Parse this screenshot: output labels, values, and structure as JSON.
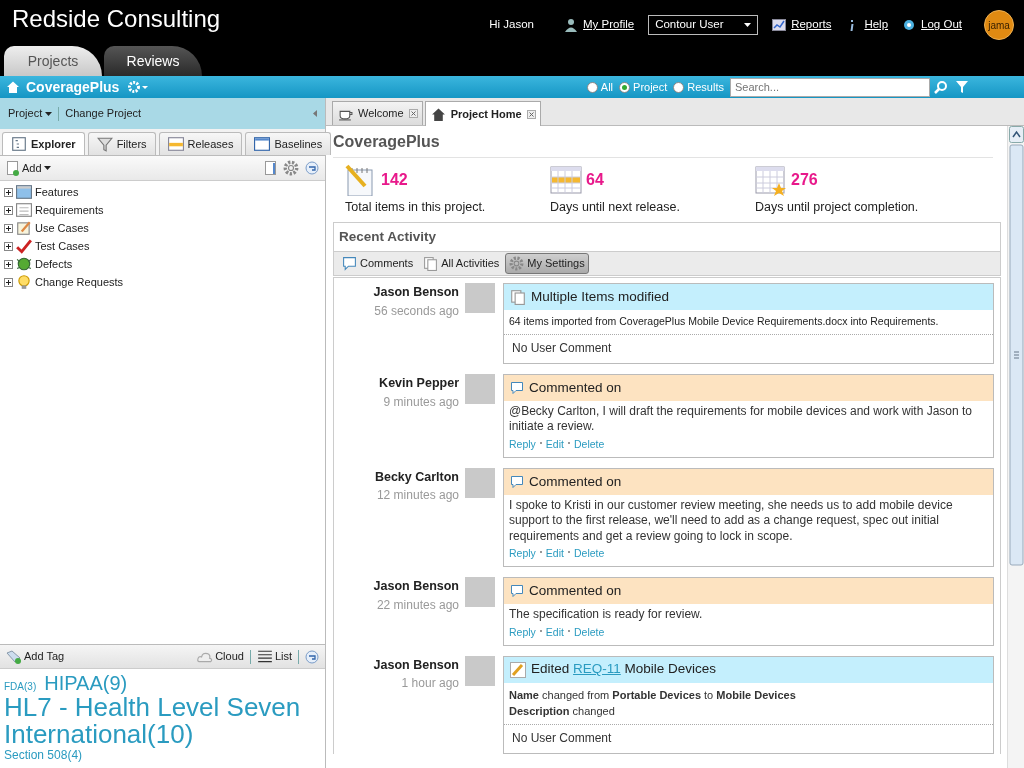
{
  "header": {
    "company": "Redside Consulting",
    "greeting": "Hi Jason",
    "logo": "jama",
    "nav": [
      {
        "kind": "profile",
        "label": "My Profile"
      },
      {
        "kind": "select",
        "label": "Contour User"
      },
      {
        "kind": "reports",
        "label": "Reports"
      },
      {
        "kind": "help",
        "label": "Help"
      },
      {
        "kind": "logout",
        "label": "Log Out"
      }
    ]
  },
  "main_tabs": [
    {
      "label": "Projects",
      "selected": true
    },
    {
      "label": "Reviews",
      "selected": false
    }
  ],
  "project_bar": {
    "name": "CoveragePlus",
    "scope": [
      {
        "label": "All",
        "selected": false
      },
      {
        "label": "Project",
        "selected": true
      },
      {
        "label": "Results",
        "selected": false
      }
    ],
    "search": {
      "placeholder": "Search..."
    }
  },
  "sidebar": {
    "menu": [
      "Project",
      "Change Project"
    ],
    "tabs": [
      {
        "label": "Explorer",
        "kind": "explorer",
        "selected": true
      },
      {
        "label": "Filters",
        "kind": "filter",
        "selected": false
      },
      {
        "label": "Releases",
        "kind": "releases",
        "selected": false
      },
      {
        "label": "Baselines",
        "kind": "baselines",
        "selected": false
      }
    ],
    "add": "Add",
    "tree": [
      {
        "label": "Features",
        "kind": "features",
        "expanded": false
      },
      {
        "label": "Requirements",
        "kind": "requirements",
        "expanded": false
      },
      {
        "label": "Use Cases",
        "kind": "usecases",
        "expanded": false
      },
      {
        "label": "Test Cases",
        "kind": "testcases",
        "expanded": false
      },
      {
        "label": "Defects",
        "kind": "defects",
        "expanded": false
      },
      {
        "label": "Change Requests",
        "kind": "changes",
        "expanded": false
      }
    ],
    "tag_toolbar": {
      "add": "Add Tag",
      "views": [
        {
          "kind": "cloud",
          "label": "Cloud"
        },
        {
          "kind": "list",
          "label": "List"
        }
      ]
    },
    "tags": [
      {
        "label": "FDA(3)",
        "kind": "tiny"
      },
      {
        "label": "HIPAA(9)",
        "kind": "medium"
      },
      {
        "label": "HL7 - Health Level Seven International(10)",
        "kind": "large"
      },
      {
        "label": "Section 508(4)",
        "kind": "small"
      }
    ]
  },
  "doc_tabs": [
    {
      "label": "Welcome",
      "kind": "welcome",
      "selected": false
    },
    {
      "label": "Project Home",
      "kind": "home",
      "selected": true
    }
  ],
  "project": {
    "title": "CoveragePlus",
    "stats": [
      {
        "kind": "items",
        "value": "142",
        "label": "Total items in this project."
      },
      {
        "kind": "release",
        "value": "64",
        "label": "Days until next release."
      },
      {
        "kind": "completion",
        "value": "276",
        "label": "Days until project completion."
      }
    ]
  },
  "recent_activity": {
    "title": "Recent Activity",
    "filters": [
      {
        "kind": "comments",
        "label": "Comments",
        "selected": false
      },
      {
        "kind": "all",
        "label": "All Activities",
        "selected": false
      },
      {
        "kind": "settings",
        "label": "My Settings",
        "selected": true
      }
    ],
    "items": [
      {
        "kind": "bulk",
        "user": "Jason Benson",
        "time": "56 seconds ago",
        "title": "Multiple Items modified",
        "detail": "64 items imported from CoveragePlus Mobile Device Requirements.docx into Requirements.",
        "comment": "No User Comment"
      },
      {
        "kind": "comment",
        "user": "Kevin Pepper",
        "time": "9 minutes ago",
        "title": "Commented on",
        "body": "@Becky Carlton, I will draft the requirements for mobile devices and work with Jason to initiate a review.",
        "actions": [
          "Reply",
          "Edit",
          "Delete"
        ]
      },
      {
        "kind": "comment",
        "user": "Becky Carlton",
        "time": "12 minutes ago",
        "title": "Commented on",
        "body": "I spoke to Kristi in our customer review meeting, she needs us to add mobile device support to the first release, we'll need to add as a change request, spec out initial requirements and get a review going to lock in scope.",
        "actions": [
          "Reply",
          "Edit",
          "Delete"
        ]
      },
      {
        "kind": "comment",
        "user": "Jason Benson",
        "time": "22 minutes ago",
        "title": "Commented on",
        "body": "The specification is ready for review.",
        "actions": [
          "Reply",
          "Edit",
          "Delete"
        ]
      },
      {
        "kind": "edit",
        "user": "Jason Benson",
        "time": "1 hour ago",
        "title": "Edited",
        "link": "REQ-11",
        "item": "Mobile Devices",
        "changes": [
          "**Name** changed from **Portable Devices** to **Mobile Devices**",
          "**Description** changed"
        ],
        "comment": "No User Comment"
      }
    ]
  }
}
